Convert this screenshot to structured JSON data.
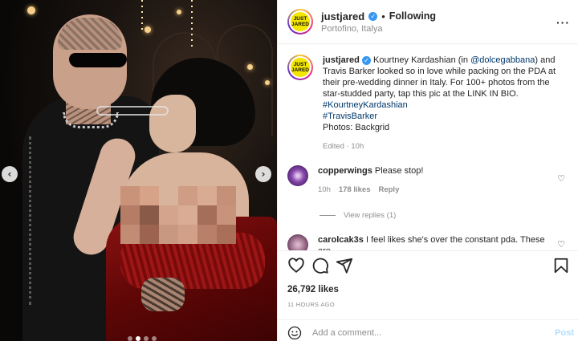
{
  "post": {
    "author": "justjared",
    "verified": true,
    "separator": "•",
    "follow_status": "Following",
    "location": "Portofino, Italya",
    "avatar_text_line1": "JUST",
    "avatar_text_line2": "JARED",
    "avatar_color": "#f3e600"
  },
  "caption": {
    "username": "justjared",
    "text_before_mention": "Kourtney Kardashian (in ",
    "mention": "@dolcegabbana",
    "text_after_mention": ") and Travis Barker looked so in love while packing on the PDA at their pre-wedding dinner in Italy. For 100+ photos from the star-studded party, tap this pic at the LINK IN BIO.",
    "hashtags": [
      "#KourtneyKardashian",
      "#TravisBarker"
    ],
    "photo_credit": "Photos: Backgrid",
    "edited": "Edited · 10h"
  },
  "comments": [
    {
      "username": "copperwings",
      "text": "Please stop!",
      "time": "10h",
      "likes": "178 likes",
      "reply_label": "Reply",
      "view_replies": "View replies (1)",
      "avatar_color": "#7b3fa0"
    },
    {
      "username": "carolcak3s",
      "text": "I feel likes she's over the constant pda. These are",
      "avatar_color": "#9a6a8a"
    }
  ],
  "stats": {
    "likes": "26,792 likes",
    "time_ago": "11 HOURS AGO"
  },
  "add_comment": {
    "placeholder": "Add a comment...",
    "post_label": "Post"
  },
  "icons": {
    "like": "heart-icon",
    "comment": "comment-icon",
    "share": "share-icon",
    "save": "bookmark-icon",
    "emoji": "emoji-icon",
    "more": "more-options-icon",
    "prev": "chevron-left-icon",
    "next": "chevron-right-icon"
  },
  "carousel": {
    "prev_glyph": "‹",
    "next_glyph": "›",
    "slides": 4,
    "active": 1
  }
}
